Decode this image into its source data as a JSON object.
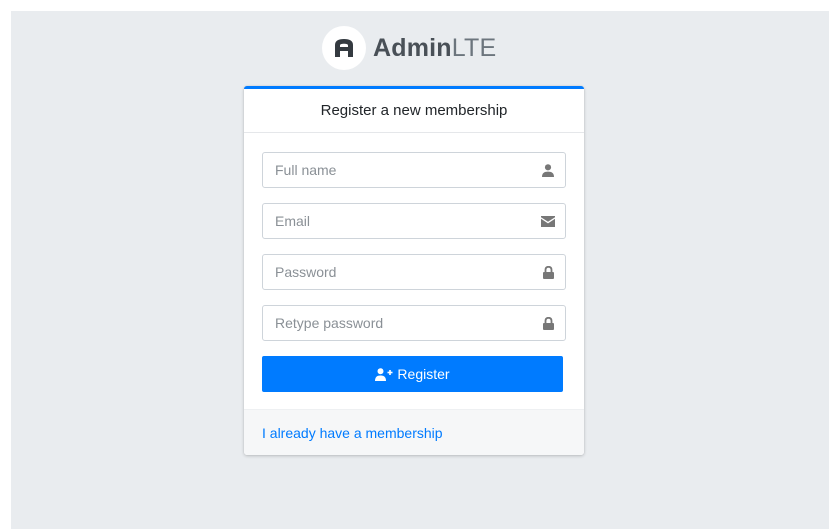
{
  "brand": {
    "logo_icon": "adminlte-logo-icon",
    "name_bold": "Admin",
    "name_light": "LTE"
  },
  "card": {
    "title": "Register a new membership",
    "accent_color": "#007bff",
    "fields": [
      {
        "placeholder": "Full name",
        "icon": "user-icon"
      },
      {
        "placeholder": "Email",
        "icon": "envelope-icon"
      },
      {
        "placeholder": "Password",
        "icon": "lock-icon"
      },
      {
        "placeholder": "Retype password",
        "icon": "lock-icon"
      }
    ],
    "register_label": "Register",
    "register_icon": "user-plus-icon",
    "membership_link": "I already have a membership"
  },
  "colors": {
    "primary": "#007bff",
    "background": "#e9ecef",
    "icon_gray": "#777777"
  }
}
